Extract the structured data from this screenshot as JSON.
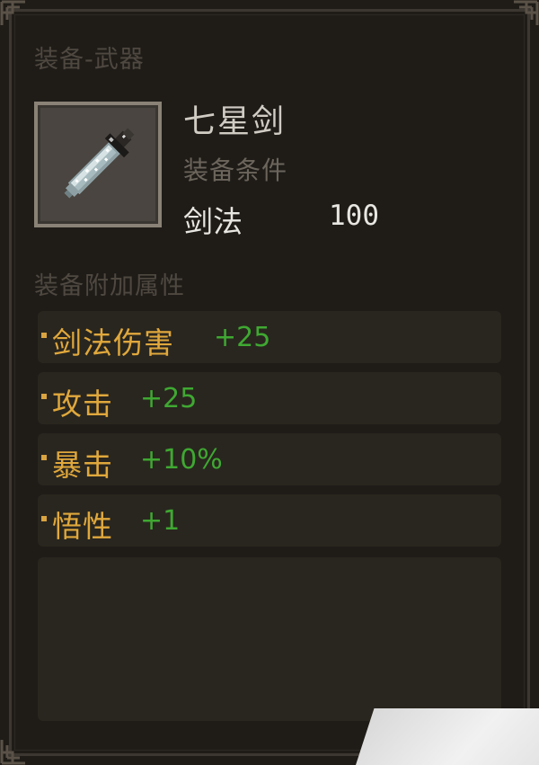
{
  "item": {
    "category": "装备-武器",
    "name": "七星剑",
    "requirement_label": "装备条件",
    "requirement_stat": "剑法",
    "requirement_value": "100",
    "icon": "sword-icon"
  },
  "bonus": {
    "title": "装备附加属性",
    "attributes": [
      {
        "name": "剑法伤害",
        "value": "+25"
      },
      {
        "name": "攻击",
        "value": "+25"
      },
      {
        "name": "暴击",
        "value": "+10%"
      },
      {
        "name": "悟性",
        "value": "+1"
      }
    ]
  },
  "colors": {
    "attribute_name": "#e0a83c",
    "attribute_value": "#3fa832",
    "panel_bg": "#1f1c18"
  }
}
